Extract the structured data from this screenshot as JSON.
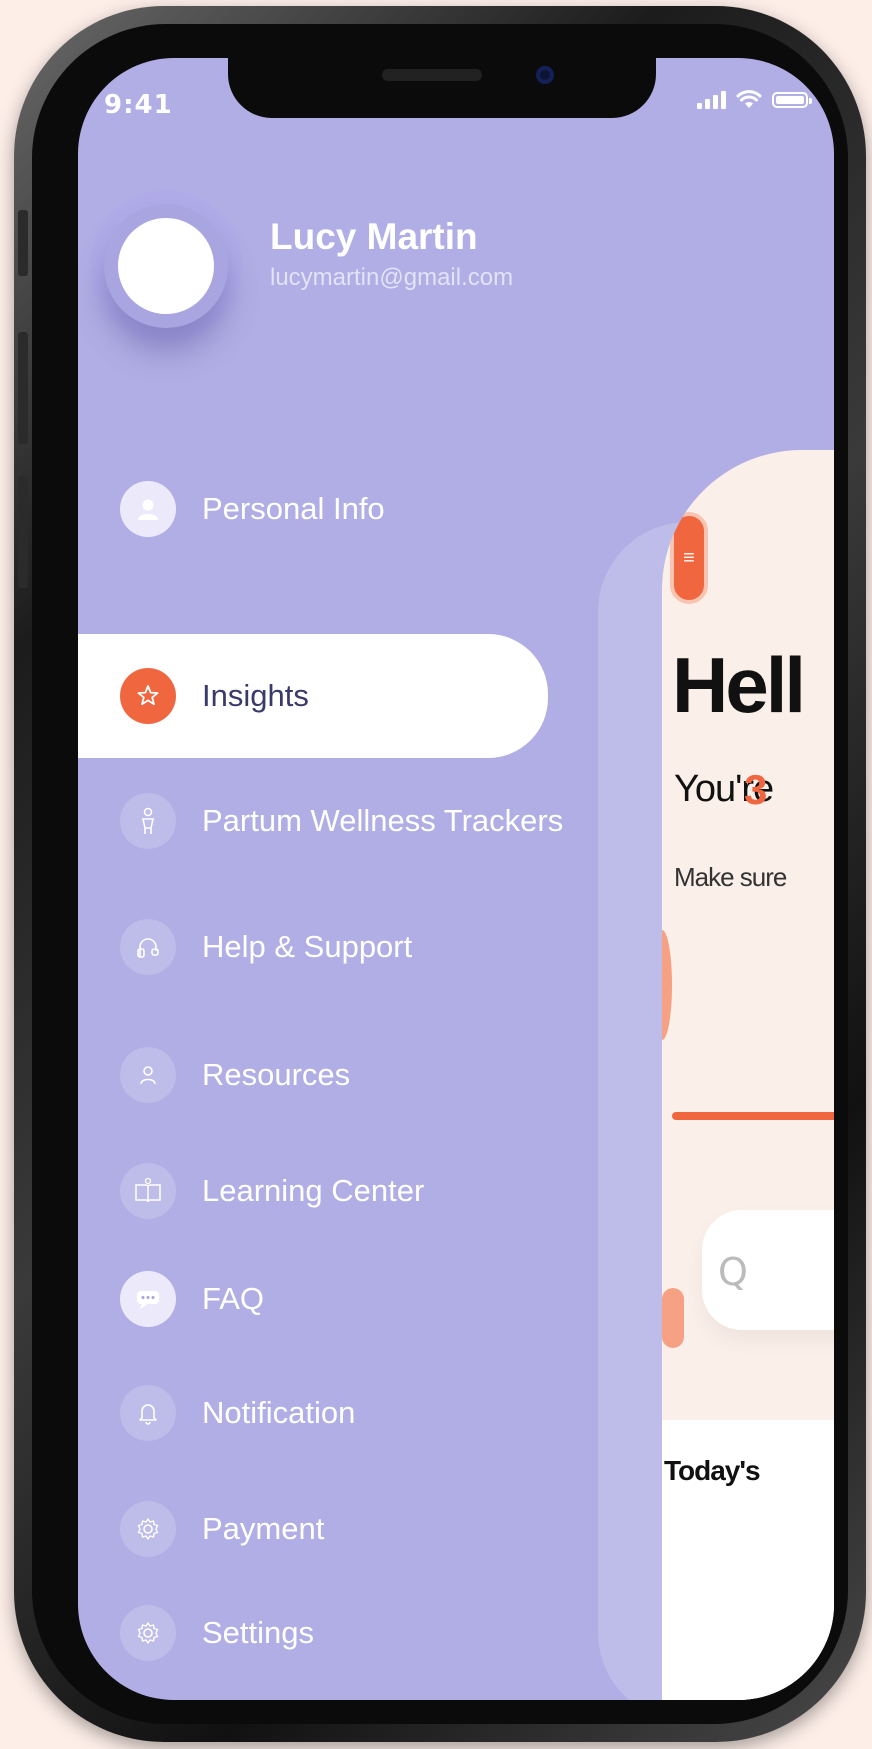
{
  "status_bar": {
    "time": "9:41"
  },
  "profile": {
    "name": "Lucy Martin",
    "email": "lucymartin@gmail.com"
  },
  "menu": {
    "items": [
      {
        "label": "Personal Info",
        "icon": "person-icon"
      },
      {
        "label": "Insights",
        "icon": "star-icon",
        "active": true
      },
      {
        "label": "Partum Wellness Trackers",
        "icon": "figure-icon"
      },
      {
        "label": "Help & Support",
        "icon": "support-icon"
      },
      {
        "label": "Resources",
        "icon": "user-outline-icon"
      },
      {
        "label": "Learning Center",
        "icon": "book-icon"
      },
      {
        "label": "FAQ",
        "icon": "chat-icon"
      },
      {
        "label": "Notification",
        "icon": "bell-icon"
      },
      {
        "label": "Payment",
        "icon": "gear-icon"
      },
      {
        "label": "Settings",
        "icon": "gear-icon"
      }
    ]
  },
  "background_screen": {
    "greeting": "Hell",
    "subtitle": "You're",
    "subtitle_number": "3",
    "hint": "Make sure",
    "section_title": "Today's"
  },
  "colors": {
    "drawer_bg": "#b0aee4",
    "accent": "#f0663f",
    "page_bg": "#fdeee8"
  }
}
